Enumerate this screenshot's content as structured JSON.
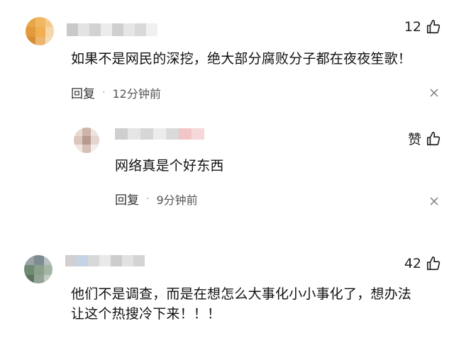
{
  "comments": [
    {
      "likes": "12",
      "text": "如果不是网民的深挖，绝大部分腐败分子都在夜夜笙歌！",
      "reply_label": "回复",
      "time": "12分钟前",
      "icons": {
        "like": "thumbs-up-icon",
        "close": "close-icon"
      },
      "reply": {
        "likes": "赞",
        "text": "网络真是个好东西",
        "reply_label": "回复",
        "time": "9分钟前"
      }
    },
    {
      "likes": "42",
      "text_line1": "他们不是调查，而是在想怎么大事化小小事化了，想办法",
      "text_line2": "让这个热搜冷下来！！！"
    }
  ]
}
